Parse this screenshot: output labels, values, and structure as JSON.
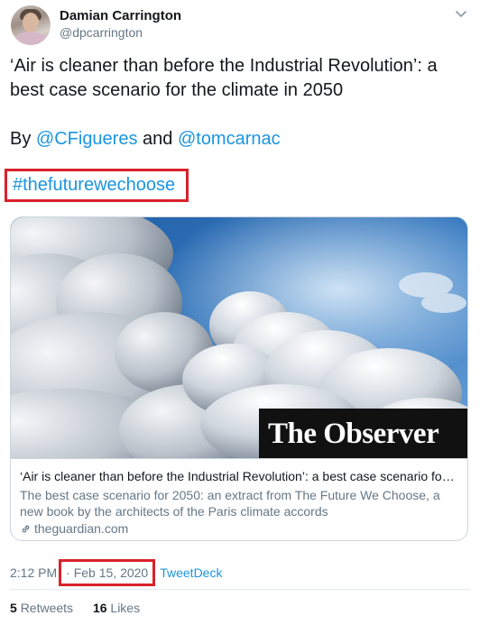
{
  "author": {
    "name": "Damian Carrington",
    "handle": "@dpcarrington"
  },
  "tweet": {
    "line1": "‘Air is cleaner than before the Industrial Revolution’: a",
    "line2": "best case scenario for the climate in 2050",
    "by_prefix": "By ",
    "mention1": "@CFigueres",
    "and_text": " and ",
    "mention2": "@tomcarnac",
    "hashtag": "#thefuturewechoose"
  },
  "card": {
    "brand": "The Observer",
    "title": "‘Air is cleaner than before the Industrial Revolution’: a best case scenario for the cl...",
    "description": "The best case scenario for 2050: an extract from The Future We Choose, a new book by the architects of the Paris climate accords",
    "domain": "theguardian.com"
  },
  "meta": {
    "time": "2:12 PM",
    "separator": "·",
    "date": "Feb 15, 2020",
    "source": "TweetDeck"
  },
  "stats": {
    "retweets_count": "5",
    "retweets_label": "Retweets",
    "likes_count": "16",
    "likes_label": "Likes"
  },
  "icons": {
    "more": "chevron-down-icon",
    "link": "link-icon"
  },
  "colors": {
    "link": "#1b95e0",
    "highlight_box": "#d9222a",
    "secondary_text": "#657786"
  }
}
